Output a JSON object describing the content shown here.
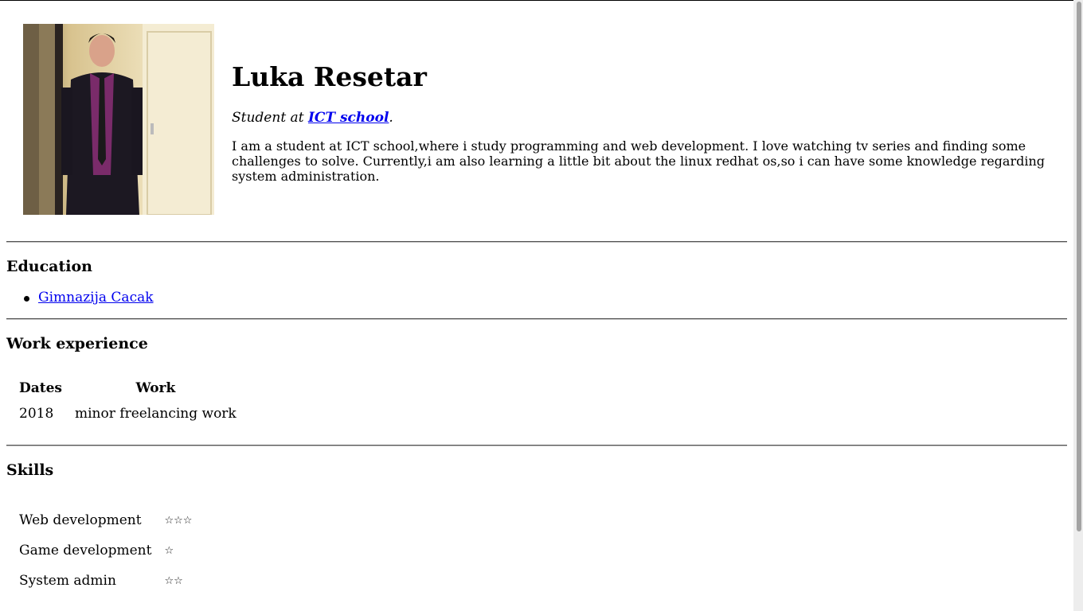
{
  "profile": {
    "name": "Luka Resetar",
    "tagline_prefix": "Student at ",
    "school_link": "ICT school",
    "tagline_suffix": ".",
    "bio": "I am a student at ICT school,where i study programming and web development. I love watching tv series and finding some challenges to solve. Currently,i am also learning a little bit about the linux redhat os,so i can have some knowledge regarding system administration."
  },
  "education": {
    "title": "Education",
    "items": [
      {
        "label": "Gimnazija Cacak"
      }
    ]
  },
  "work": {
    "title": "Work experience",
    "headers": [
      "Dates",
      "Work"
    ],
    "rows": [
      {
        "date": "2018",
        "work": "minor freelancing work"
      }
    ]
  },
  "skills": {
    "title": "Skills",
    "items": [
      {
        "name": "Web development",
        "stars": "☆☆☆",
        "rating": 3
      },
      {
        "name": "Game development",
        "stars": "☆",
        "rating": 1
      },
      {
        "name": "System admin",
        "stars": "☆☆",
        "rating": 2
      }
    ]
  },
  "colors": {
    "link": "#0000ee",
    "rule": "#555555"
  }
}
